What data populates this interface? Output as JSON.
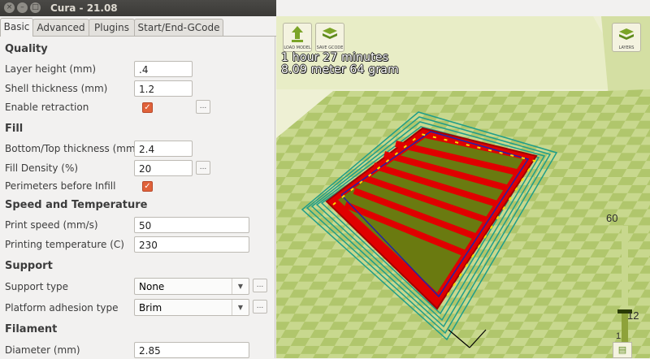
{
  "window": {
    "title": "Cura - 21.08"
  },
  "tabs": [
    {
      "label": "Basic"
    },
    {
      "label": "Advanced"
    },
    {
      "label": "Plugins"
    },
    {
      "label": "Start/End-GCode"
    }
  ],
  "quality": {
    "heading": "Quality",
    "layer_height": {
      "label": "Layer height (mm)",
      "value": ".4"
    },
    "shell_thickness": {
      "label": "Shell thickness (mm)",
      "value": "1.2"
    },
    "retraction": {
      "label": "Enable retraction",
      "checked": true,
      "more_label": "..."
    }
  },
  "fill": {
    "heading": "Fill",
    "bottom_top": {
      "label": "Bottom/Top thickness (mm)",
      "value": "2.4"
    },
    "density": {
      "label": "Fill Density (%)",
      "value": "20",
      "more_label": "..."
    },
    "perimeters": {
      "label": "Perimeters before Infill",
      "checked": true
    }
  },
  "speed": {
    "heading": "Speed and Temperature",
    "print_speed": {
      "label": "Print speed (mm/s)",
      "value": "50"
    },
    "print_temp": {
      "label": "Printing temperature (C)",
      "value": "230"
    }
  },
  "support": {
    "heading": "Support",
    "support_type": {
      "label": "Support type",
      "value": "None",
      "more_label": "..."
    },
    "adhesion": {
      "label": "Platform adhesion type",
      "value": "Brim",
      "more_label": "..."
    }
  },
  "filament": {
    "heading": "Filament",
    "diameter": {
      "label": "Diameter (mm)",
      "value": "2.85"
    }
  },
  "viewport": {
    "load_model_label": "LOAD MODEL",
    "save_gcode_label": "SAVE GCODE",
    "view_mode_label": "LAYERS",
    "print_time": "1 hour 27 minutes",
    "print_stats": "8.09 meter 64 gram",
    "layer_max": "60",
    "layer_current": "12",
    "layer_min": "1",
    "current_layer_fraction": 0.2
  }
}
